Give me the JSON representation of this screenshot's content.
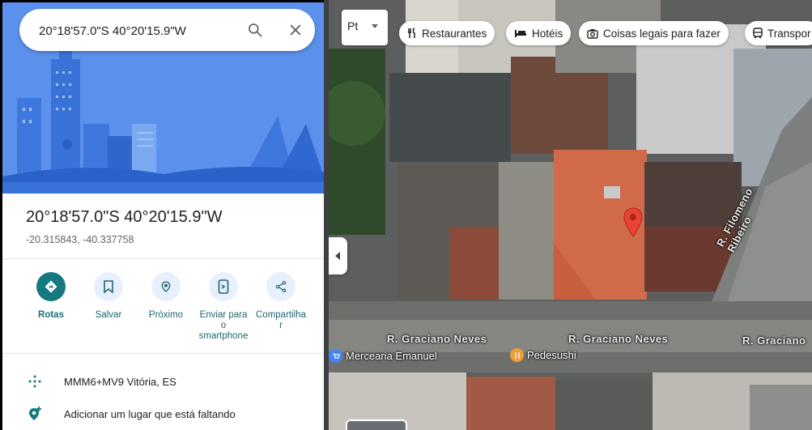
{
  "search": {
    "value": "20°18'57.0\"S 40°20'15.9\"W"
  },
  "place": {
    "title": "20°18'57.0\"S 40°20'15.9\"W",
    "decimal_coords": "-20.315843, -40.337758"
  },
  "actions": [
    {
      "label": "Rotas",
      "icon": "directions-icon"
    },
    {
      "label": "Salvar",
      "icon": "bookmark-icon"
    },
    {
      "label": "Próximo",
      "icon": "nearby-icon"
    },
    {
      "label_lines": [
        "Enviar para",
        "o",
        "smartphone"
      ],
      "icon": "send-to-phone-icon"
    },
    {
      "label_lines": [
        "Compartilha",
        "r"
      ],
      "icon": "share-icon"
    }
  ],
  "info_rows": [
    {
      "text": "MMM6+MV9 Vitória, ES",
      "icon": "plus-code-icon"
    },
    {
      "text": "Adicionar um lugar que está faltando",
      "icon": "add-place-icon"
    }
  ],
  "map": {
    "layer_label": "Pt",
    "chips": [
      {
        "label": "Restaurantes",
        "icon": "fork-knife-icon"
      },
      {
        "label": "Hotéis",
        "icon": "bed-icon"
      },
      {
        "label": "Coisas legais para fazer",
        "icon": "camera-icon"
      },
      {
        "label": "Transpor",
        "icon": "bus-icon"
      }
    ],
    "streets": [
      {
        "label": "R. Graciano Neves"
      },
      {
        "label": "R. Graciano Neves"
      },
      {
        "label": "R. Graciano"
      },
      {
        "label": "R. Filomeno Ribeiro"
      }
    ],
    "pois": [
      {
        "label": "Mercearia Emanuel",
        "color": "#4285f4"
      },
      {
        "label": "Pedesushi",
        "color": "#f29c38"
      }
    ],
    "pin_color": "#ea4335"
  },
  "colors": {
    "accent": "#15797f",
    "hero_blue": "#5d93ee"
  }
}
